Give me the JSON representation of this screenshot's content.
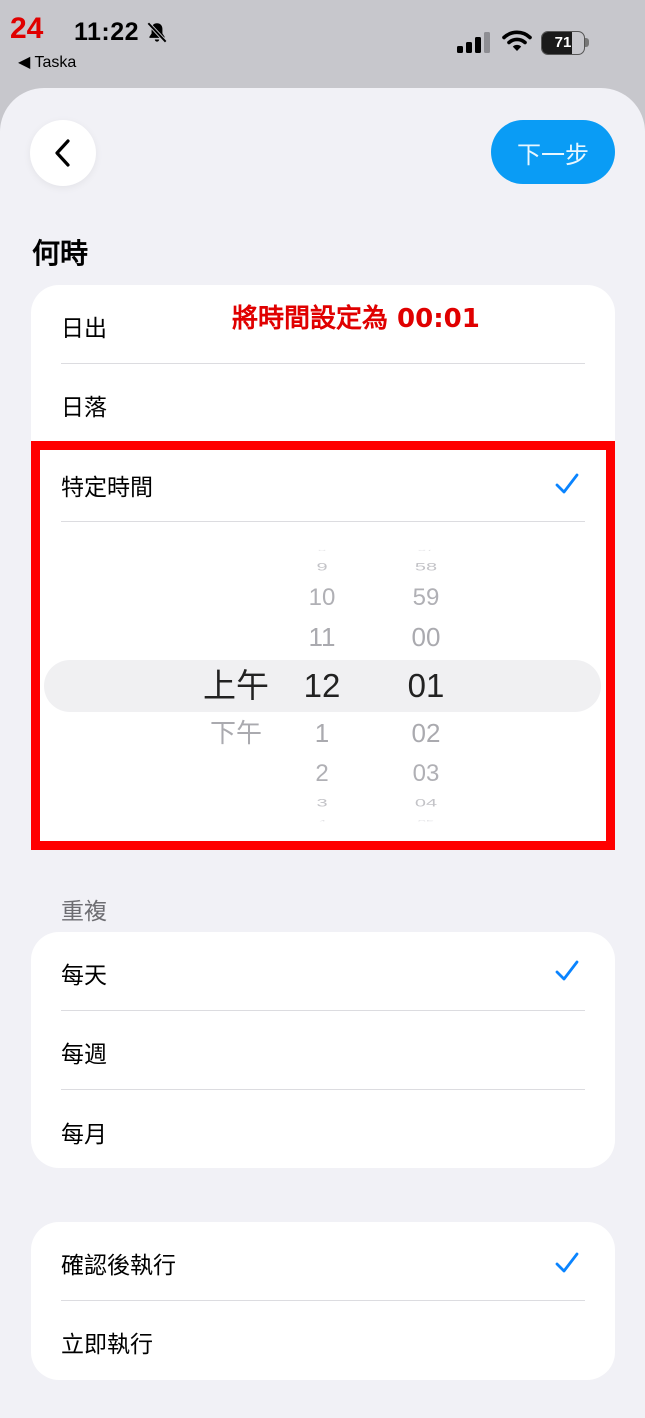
{
  "status_bar": {
    "step_number": "24",
    "time": "11:22",
    "back_app": "◀ Taska",
    "battery": "71",
    "battery_level": 0.71
  },
  "nav": {
    "next_label": "下一步"
  },
  "when": {
    "title": "何時",
    "annotation": "將時間設定為 00:01",
    "options": [
      "日出",
      "日落",
      "特定時間"
    ],
    "selected": "特定時間"
  },
  "time_picker": {
    "period": {
      "above": [],
      "selected": "上午",
      "below": [
        "下午"
      ]
    },
    "hour": {
      "above": [
        "8",
        "9",
        "10",
        "11"
      ],
      "selected": "12",
      "below": [
        "1",
        "2",
        "3",
        "4"
      ]
    },
    "minute": {
      "above": [
        "57",
        "58",
        "59",
        "00"
      ],
      "selected": "01",
      "below": [
        "02",
        "03",
        "04",
        "05"
      ]
    }
  },
  "repeat": {
    "title": "重複",
    "options": [
      "每天",
      "每週",
      "每月"
    ],
    "selected": "每天"
  },
  "execution": {
    "options": [
      "確認後執行",
      "立即執行"
    ],
    "selected": "確認後執行"
  },
  "colors": {
    "accent": "#0a84ff",
    "next_button": "#0a9cf5",
    "annotation_red": "#ff0000"
  }
}
